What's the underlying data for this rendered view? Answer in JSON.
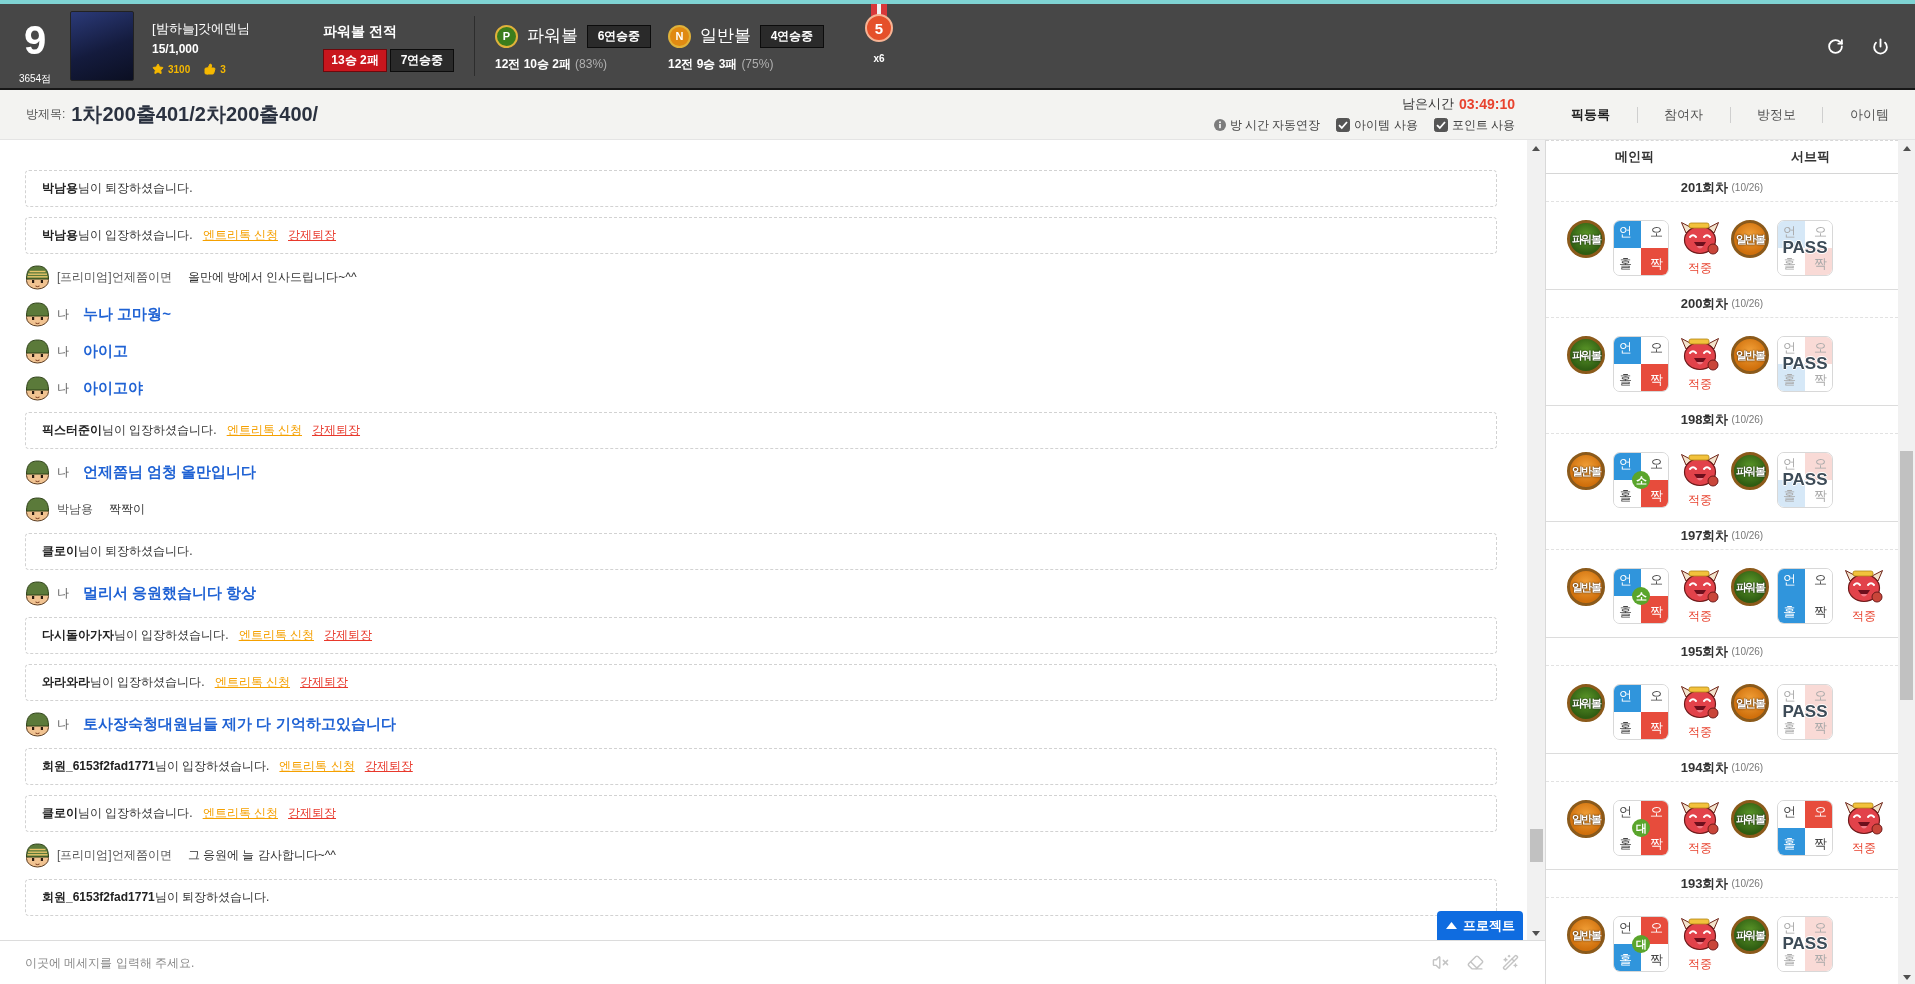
{
  "header": {
    "level": "9",
    "score": "3654점",
    "user": {
      "name": "[밤하늘]갓에덴님",
      "points": "15/1,000",
      "star_points": "3100",
      "likes": "3"
    },
    "record": {
      "title": "파워볼 전적",
      "result": "13승 2패",
      "streak": "7연승중"
    },
    "balls": [
      {
        "kind": "power",
        "letter": "P",
        "name": "파워볼",
        "streak": "6연승중",
        "summary": "12전 10승 2패",
        "rate": "(83%)"
      },
      {
        "kind": "normal",
        "letter": "N",
        "name": "일반볼",
        "streak": "4연승중",
        "summary": "12전 9승 3패",
        "rate": "(75%)"
      }
    ],
    "medal": {
      "rank": "5",
      "count": "x6"
    }
  },
  "room": {
    "label": "방제목:",
    "title": "1차200출401/2차200출400/",
    "timer_label": "남은시간",
    "timer": "03:49:10",
    "auto_extend": "방 시간 자동연장",
    "options": [
      {
        "label": "아이템 사용",
        "checked": true
      },
      {
        "label": "포인트 사용",
        "checked": true
      }
    ]
  },
  "tabs": [
    {
      "label": "픽등록",
      "selected": true
    },
    {
      "label": "참여자",
      "selected": false
    },
    {
      "label": "방정보",
      "selected": false
    },
    {
      "label": "아이템",
      "selected": false
    }
  ],
  "chat": {
    "messages": [
      {
        "kind": "system",
        "text": "**박남용**님이 퇴장하셨습니다."
      },
      {
        "kind": "system",
        "text": "**박남용**님이 입장하셨습니다.",
        "links": [
          {
            "label": "엔트리톡 신청",
            "color": "#f5a000"
          },
          {
            "label": "강제퇴장",
            "color": "#e8392c"
          }
        ]
      },
      {
        "kind": "chat",
        "premium": true,
        "mine": false,
        "name": "[프리미엄]언제쯤이면",
        "text": "올만에 방에서 인사드립니다~^^"
      },
      {
        "kind": "chat",
        "premium": false,
        "mine": true,
        "name": "나",
        "text": "누나 고마웡~"
      },
      {
        "kind": "chat",
        "premium": false,
        "mine": true,
        "name": "나",
        "text": "아이고"
      },
      {
        "kind": "chat",
        "premium": false,
        "mine": true,
        "name": "나",
        "text": "아이고야"
      },
      {
        "kind": "system",
        "text": "**픽스터준이**님이 입장하셨습니다.",
        "links": [
          {
            "label": "엔트리톡 신청",
            "color": "#f5a000"
          },
          {
            "label": "강제퇴장",
            "color": "#e8392c"
          }
        ]
      },
      {
        "kind": "chat",
        "premium": false,
        "mine": true,
        "name": "나",
        "text": "언제쯤님 엄청 올만입니다"
      },
      {
        "kind": "chat",
        "premium": false,
        "mine": false,
        "name": "박남용",
        "text": "짝짝이"
      },
      {
        "kind": "system",
        "text": "**클로이**님이 퇴장하셨습니다."
      },
      {
        "kind": "chat",
        "premium": false,
        "mine": true,
        "name": "나",
        "text": "멀리서 응원했습니다 항상"
      },
      {
        "kind": "system",
        "text": "**다시돌아가자**님이 입장하셨습니다.",
        "links": [
          {
            "label": "엔트리톡 신청",
            "color": "#f5a000"
          },
          {
            "label": "강제퇴장",
            "color": "#e8392c"
          }
        ]
      },
      {
        "kind": "system",
        "text": "**와라와라**님이 입장하셨습니다.",
        "links": [
          {
            "label": "엔트리톡 신청",
            "color": "#f5a000"
          },
          {
            "label": "강제퇴장",
            "color": "#e8392c"
          }
        ]
      },
      {
        "kind": "chat",
        "premium": false,
        "mine": true,
        "name": "나",
        "text": "토사장숙청대원님들 제가 다 기억하고있습니다"
      },
      {
        "kind": "system",
        "text": "**회원_6153f2fad1771**님이 입장하셨습니다.",
        "links": [
          {
            "label": "엔트리톡 신청",
            "color": "#f5a000"
          },
          {
            "label": "강제퇴장",
            "color": "#e8392c"
          }
        ]
      },
      {
        "kind": "system",
        "text": "**클로이**님이 입장하셨습니다.",
        "links": [
          {
            "label": "엔트리톡 신청",
            "color": "#f5a000"
          },
          {
            "label": "강제퇴장",
            "color": "#e8392c"
          }
        ]
      },
      {
        "kind": "chat",
        "premium": true,
        "mine": false,
        "name": "[프리미엄]언제쯤이면",
        "text": "그 응원에 늘 감사합니다~^^"
      },
      {
        "kind": "system",
        "text": "**회원_6153f2fad1771**님이 퇴장하셨습니다."
      }
    ],
    "input": {
      "placeholder": "이곳에 메세지를 입력해 주세요."
    },
    "project_button": "프로젝트"
  },
  "picks": {
    "columns": [
      "메인픽",
      "서브픽"
    ],
    "rounds": [
      {
        "title": "201회차",
        "date": "(10/26)",
        "picks": [
          {
            "ball": {
              "kind": "power",
              "label": "파워볼"
            },
            "cells": [
              {
                "label": "언",
                "selected": true
              },
              {
                "label": "오",
                "selected": false
              },
              {
                "label": "홀",
                "selected": false
              },
              {
                "label": "짝",
                "selected": true
              }
            ],
            "result": "적중"
          },
          {
            "ball": {
              "kind": "normal",
              "label": "일반볼"
            },
            "cells": [
              {
                "label": "언",
                "selected": true
              },
              {
                "label": "오",
                "selected": false
              },
              {
                "label": "홀",
                "selected": false
              },
              {
                "label": "짝",
                "selected": true
              }
            ],
            "stamp": "PASS"
          }
        ]
      },
      {
        "title": "200회차",
        "date": "(10/26)",
        "picks": [
          {
            "ball": {
              "kind": "power",
              "label": "파워볼"
            },
            "cells": [
              {
                "label": "언",
                "selected": true
              },
              {
                "label": "오",
                "selected": false
              },
              {
                "label": "홀",
                "selected": false
              },
              {
                "label": "짝",
                "selected": true
              }
            ],
            "result": "적중"
          },
          {
            "ball": {
              "kind": "normal",
              "label": "일반볼"
            },
            "cells": [
              {
                "label": "언",
                "selected": false
              },
              {
                "label": "오",
                "selected": true
              },
              {
                "label": "홀",
                "selected": true
              },
              {
                "label": "짝",
                "selected": false
              }
            ],
            "stamp": "PASS"
          }
        ]
      },
      {
        "title": "198회차",
        "date": "(10/26)",
        "picks": [
          {
            "ball": {
              "kind": "normal",
              "label": "일반볼"
            },
            "cells": [
              {
                "label": "언",
                "selected": true
              },
              {
                "label": "오",
                "selected": false
              },
              {
                "label": "홀",
                "selected": false
              },
              {
                "label": "짝",
                "selected": true
              }
            ],
            "badge": "소",
            "result": "적중"
          },
          {
            "ball": {
              "kind": "power",
              "label": "파워볼"
            },
            "cells": [
              {
                "label": "언",
                "selected": false
              },
              {
                "label": "오",
                "selected": true
              },
              {
                "label": "홀",
                "selected": true
              },
              {
                "label": "짝",
                "selected": false
              }
            ],
            "stamp": "PASS"
          }
        ]
      },
      {
        "title": "197회차",
        "date": "(10/26)",
        "picks": [
          {
            "ball": {
              "kind": "normal",
              "label": "일반볼"
            },
            "cells": [
              {
                "label": "언",
                "selected": true
              },
              {
                "label": "오",
                "selected": false
              },
              {
                "label": "홀",
                "selected": false
              },
              {
                "label": "짝",
                "selected": true
              }
            ],
            "badge": "소",
            "result": "적중"
          },
          {
            "ball": {
              "kind": "power",
              "label": "파워볼"
            },
            "cells": [
              {
                "label": "언",
                "selected": true
              },
              {
                "label": "오",
                "selected": false
              },
              {
                "label": "홀",
                "selected": true
              },
              {
                "label": "짝",
                "selected": false
              }
            ],
            "result": "적중"
          }
        ]
      },
      {
        "title": "195회차",
        "date": "(10/26)",
        "picks": [
          {
            "ball": {
              "kind": "power",
              "label": "파워볼"
            },
            "cells": [
              {
                "label": "언",
                "selected": true
              },
              {
                "label": "오",
                "selected": false
              },
              {
                "label": "홀",
                "selected": false
              },
              {
                "label": "짝",
                "selected": true
              }
            ],
            "result": "적중"
          },
          {
            "ball": {
              "kind": "normal",
              "label": "일반볼"
            },
            "cells": [
              {
                "label": "언",
                "selected": false
              },
              {
                "label": "오",
                "selected": true
              },
              {
                "label": "홀",
                "selected": false
              },
              {
                "label": "짝",
                "selected": true
              }
            ],
            "stamp": "PASS"
          }
        ]
      },
      {
        "title": "194회차",
        "date": "(10/26)",
        "picks": [
          {
            "ball": {
              "kind": "normal",
              "label": "일반볼"
            },
            "cells": [
              {
                "label": "언",
                "selected": false
              },
              {
                "label": "오",
                "selected": true
              },
              {
                "label": "홀",
                "selected": false
              },
              {
                "label": "짝",
                "selected": true
              }
            ],
            "badge": "대",
            "result": "적중"
          },
          {
            "ball": {
              "kind": "power",
              "label": "파워볼"
            },
            "cells": [
              {
                "label": "언",
                "selected": false
              },
              {
                "label": "오",
                "selected": true
              },
              {
                "label": "홀",
                "selected": true
              },
              {
                "label": "짝",
                "selected": false
              }
            ],
            "result": "적중"
          }
        ]
      },
      {
        "title": "193회차",
        "date": "(10/26)",
        "picks": [
          {
            "ball": {
              "kind": "normal",
              "label": "일반볼"
            },
            "cells": [
              {
                "label": "언",
                "selected": false
              },
              {
                "label": "오",
                "selected": true
              },
              {
                "label": "홀",
                "selected": true
              },
              {
                "label": "짝",
                "selected": false
              }
            ],
            "badge": "대",
            "result": "적중"
          },
          {
            "ball": {
              "kind": "power",
              "label": "파워볼"
            },
            "cells": [
              {
                "label": "언",
                "selected": false
              },
              {
                "label": "오",
                "selected": true
              },
              {
                "label": "홀",
                "selected": false
              },
              {
                "label": "짝",
                "selected": true
              }
            ],
            "stamp": "PASS"
          }
        ]
      }
    ]
  }
}
